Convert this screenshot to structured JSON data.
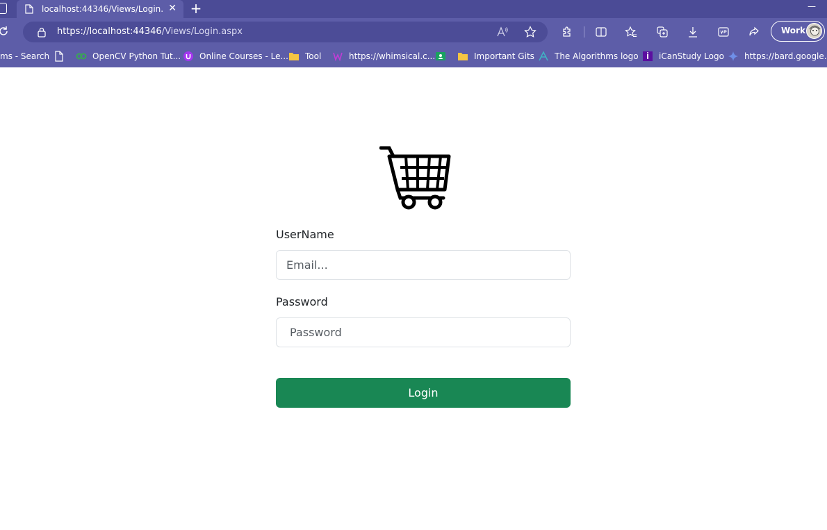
{
  "browser": {
    "tab": {
      "title": "localhost:44346/Views/Login.aspx",
      "close_glyph": "✕"
    },
    "new_tab_glyph": "+",
    "minimize_glyph": "—",
    "address": {
      "host": "https://localhost:44346",
      "path": "/Views/Login.aspx"
    },
    "profile": {
      "label": "Work"
    },
    "bookmarks": [
      {
        "label": "ms - Search",
        "icon": "search-icon"
      },
      {
        "label": "",
        "icon": "page-icon"
      },
      {
        "label": "OpenCV Python Tut...",
        "icon": "opencv-icon"
      },
      {
        "label": "Online Courses - Le...",
        "icon": "udemy-icon"
      },
      {
        "label": "Tool",
        "icon": "folder-icon"
      },
      {
        "label": "https://whimsical.c...",
        "icon": "whimsical-icon"
      },
      {
        "label": "",
        "icon": "classroom-icon"
      },
      {
        "label": "Important Gits",
        "icon": "folder-icon"
      },
      {
        "label": "The Algorithms logo",
        "icon": "algorithms-icon"
      },
      {
        "label": "iCanStudy Logo",
        "icon": "icanstudy-icon"
      },
      {
        "label": "https://bard.google...",
        "icon": "bard-icon"
      }
    ]
  },
  "login": {
    "logo_icon": "shopping-cart-icon",
    "username_label": "UserName",
    "username_placeholder": "Email...",
    "password_label": "Password",
    "password_placeholder": "Password",
    "submit_label": "Login"
  },
  "colors": {
    "browser_frame": "#5d5da8",
    "tab_strip": "#4b4b96",
    "login_button": "#198754"
  }
}
